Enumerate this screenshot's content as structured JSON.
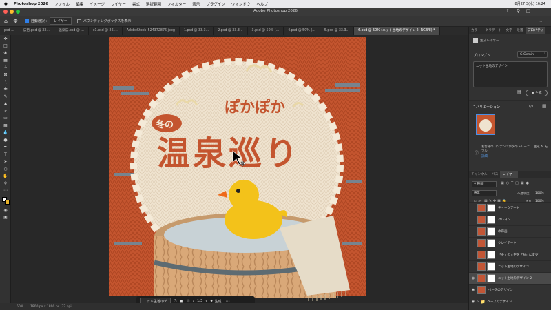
{
  "menubar": {
    "apple": "",
    "app": "Photoshop 2026",
    "items": [
      "ファイル",
      "編集",
      "イメージ",
      "レイヤー",
      "書式",
      "選択範囲",
      "フィルター",
      "表示",
      "プラグイン",
      "ウィンドウ",
      "ヘルプ"
    ],
    "clock": "8月27日(木) 16:24"
  },
  "window": {
    "title": "Adobe Photoshop 2026"
  },
  "options": {
    "auto_select": "自動選択 :",
    "target": "レイヤー",
    "bbox": "バウンディングボックスを表示"
  },
  "tabs": [
    {
      "label": "psd ..."
    },
    {
      "label": "広告.psd @ 33..."
    },
    {
      "label": "温泉広.psd @ ..."
    },
    {
      "label": "c1.psd @ 26...."
    },
    {
      "label": "AdobeStock_524372876.jpeg"
    },
    {
      "label": "1.psd @ 33.3..."
    },
    {
      "label": "2.psd @ 33.3..."
    },
    {
      "label": "3.psd @ 50% (..."
    },
    {
      "label": "4.psd @ 50% (..."
    },
    {
      "label": "5.psd @ 33.3..."
    },
    {
      "label": "6.psd @ 50% (ニット生地のデザイン 2, RGB/8) *"
    }
  ],
  "artwork": {
    "top_small": "ぽかぽか",
    "badge": "冬の",
    "headline": "温泉巡り"
  },
  "panel": {
    "tabs": [
      "カラー",
      "グラデート",
      "文字",
      "段落",
      "プロパティ"
    ],
    "generator_label": "生成レイヤー",
    "prompt_title": "プロンプト",
    "model": "Gemini",
    "prompt_text": "ニット生地のデザイン",
    "generate": "生成",
    "variations_title": "バリエーション",
    "variations_count": "1/1",
    "notice": "お客様のコンテンツが次のトレーニ... 生成 AI モデル",
    "notice_link": "詳細",
    "layers_tabs": [
      "チャンネル",
      "パス",
      "レイヤー"
    ],
    "filter": "種類",
    "blend": "通常",
    "opacity_label": "不透明度:",
    "opacity": "100%",
    "lock_label": "ロック:",
    "fill_label": "塗り:",
    "fill": "100%"
  },
  "layers": [
    {
      "name": "チョークアート",
      "visible": false,
      "selected": false
    },
    {
      "name": "クレヨン",
      "visible": false,
      "selected": false
    },
    {
      "name": "水彩画",
      "visible": false,
      "selected": false
    },
    {
      "name": "クレイアート",
      "visible": false,
      "selected": false
    },
    {
      "name": "「冬」の文字を「秋」に変更",
      "visible": false,
      "selected": false
    },
    {
      "name": "ニット生地のデザイン",
      "visible": false,
      "selected": false
    },
    {
      "name": "ニット生地のデザイン 2",
      "visible": true,
      "selected": true
    },
    {
      "name": "ベースのデザイン",
      "visible": true,
      "selected": false
    },
    {
      "name": "ベースのデザイン",
      "visible": true,
      "selected": false
    }
  ],
  "floatbar": {
    "label": "ニット生地のデ",
    "page": "1/3",
    "generate": "生成"
  },
  "status": {
    "zoom": "50%",
    "size": "1800 px x 1800 px (72 ppi)"
  }
}
